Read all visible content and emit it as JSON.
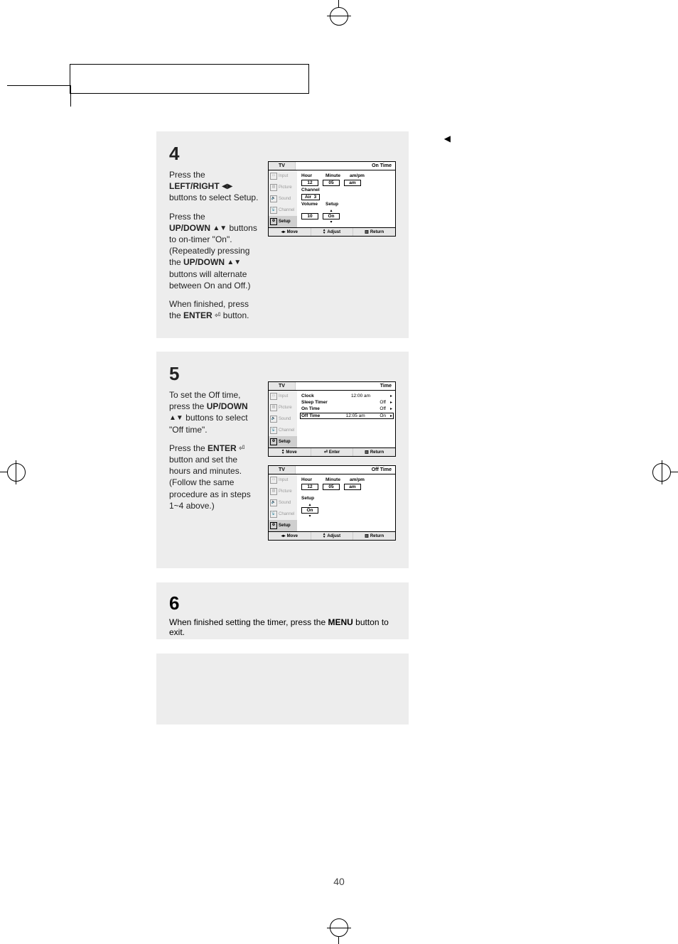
{
  "page_number": "40",
  "steps": {
    "s4": {
      "num": "4",
      "p1a": "Press the",
      "p1b": "LEFT/RIGHT",
      "p1c": "buttons to select Setup.",
      "p2a": "Press the",
      "p2b": "UP/DOWN",
      "p2c": " buttons to on-timer \"On\". (Repeatedly pressing the ",
      "p2d": "UP/DOWN",
      "p2e": " buttons will alternate between On and Off.)",
      "p3a": "When finished, press the ",
      "p3b": "ENTER",
      "p3c": " button."
    },
    "s5": {
      "num": "5",
      "p1a": "To set the Off time, press the ",
      "p1b": "UP/DOWN",
      "p1c": " buttons to select \"Off time\".",
      "p2a": "Press the ",
      "p2b": "ENTER",
      "p2c": " button and set the hours and minutes. (Follow the same procedure as in steps 1~4 above.)"
    },
    "s6": {
      "num": "6",
      "p1a": "When finished setting the timer, press the ",
      "p1b": "MENU",
      "p1c": " button to exit."
    }
  },
  "osd": {
    "tv_label": "TV",
    "footer": {
      "move_lr": "Move",
      "move_ud": "Move",
      "adjust": "Adjust",
      "enter": "Enter",
      "return": "Return"
    },
    "sidebar": {
      "input": "Input",
      "picture": "Picture",
      "sound": "Sound",
      "channel": "Channel",
      "setup": "Setup"
    },
    "fig1": {
      "corner_title": "On Time",
      "labels": {
        "hour": "Hour",
        "minute": "Minute",
        "ampm": "am/pm",
        "channel": "Channel",
        "volume": "Volume",
        "setup": "Setup"
      },
      "values": {
        "hour": "12",
        "minute": "05",
        "ampm": "am",
        "channel_src": "Air",
        "channel_num": "3",
        "volume": "10",
        "setup": "On"
      }
    },
    "fig2": {
      "corner_title": "Time",
      "rows": {
        "clock": {
          "label": "Clock",
          "value": "12:00 am"
        },
        "sleep": {
          "label": "Sleep Timer",
          "value": "Off"
        },
        "on_time": {
          "label": "On Time",
          "value": "Off"
        },
        "off_time": {
          "label": "Off Time",
          "value1": "12:05 am",
          "value2": "On"
        }
      }
    },
    "fig3": {
      "corner_title": "Off Time",
      "labels": {
        "hour": "Hour",
        "minute": "Minute",
        "ampm": "am/pm",
        "setup": "Setup"
      },
      "values": {
        "hour": "12",
        "minute": "05",
        "ampm": "am",
        "setup": "On"
      }
    }
  }
}
